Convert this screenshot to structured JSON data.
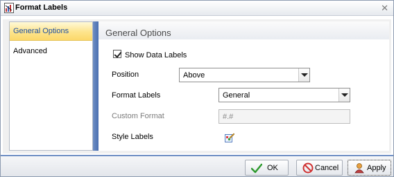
{
  "dialog": {
    "title": "Format Labels"
  },
  "sidebar": {
    "items": [
      {
        "label": "General Options",
        "selected": true
      },
      {
        "label": "Advanced",
        "selected": false
      }
    ]
  },
  "panel": {
    "title": "General Options",
    "show_data_labels": {
      "label": "Show Data Labels",
      "checked": true
    },
    "position": {
      "label": "Position",
      "value": "Above"
    },
    "format_labels": {
      "label": "Format Labels",
      "value": "General"
    },
    "custom_format": {
      "label": "Custom Format",
      "value": "#.#"
    },
    "style_labels": {
      "label": "Style Labels",
      "icon": "style-edit-icon"
    }
  },
  "footer": {
    "ok_label": "OK",
    "cancel_label": "Cancel",
    "apply_label": "Apply"
  },
  "colors": {
    "accent": "#4a6fb0",
    "selected_tab": "#fde48c",
    "ok_check": "#2e9a2e",
    "cancel_red": "#d03030"
  }
}
